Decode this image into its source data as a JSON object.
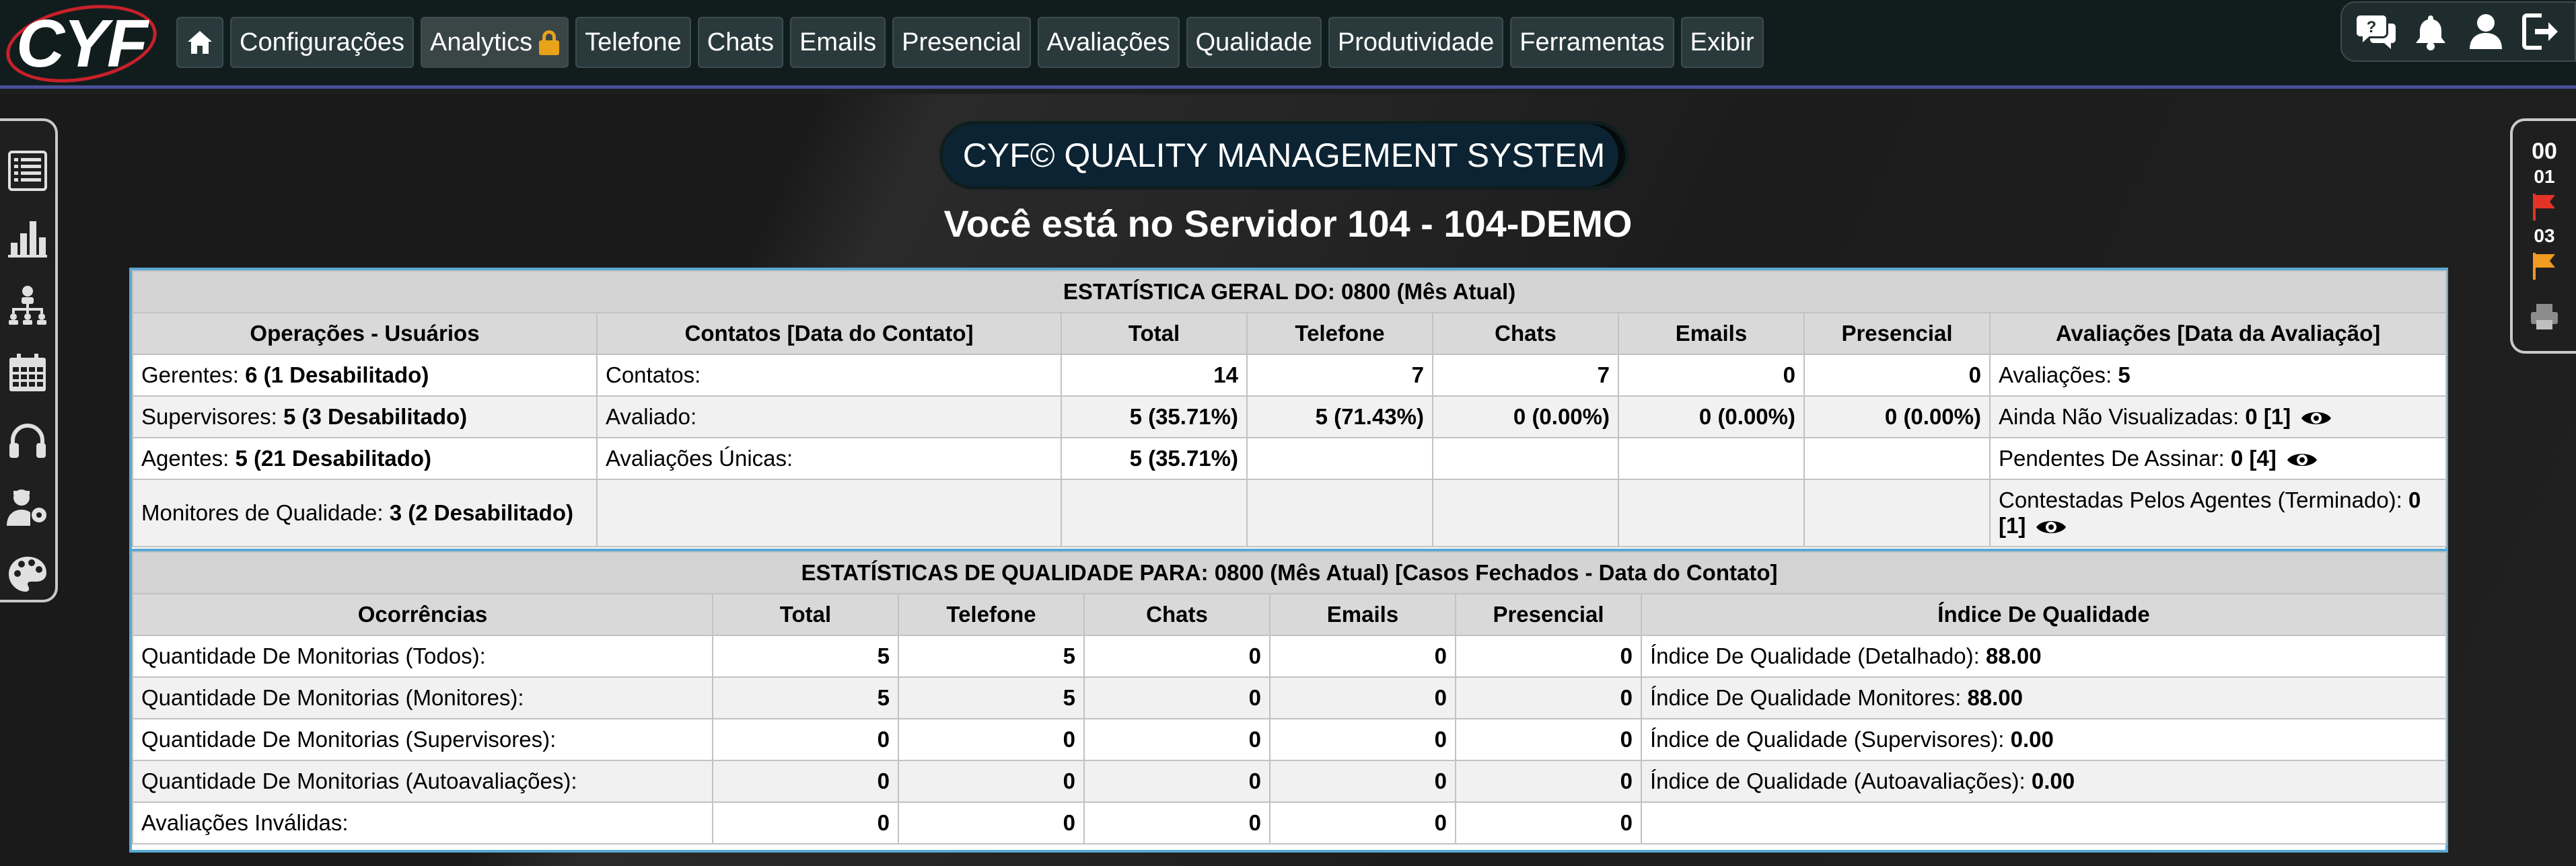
{
  "app": {
    "logo_text": "CYF"
  },
  "nav": {
    "items": [
      "Configurações",
      "Analytics",
      "Telefone",
      "Chats",
      "Emails",
      "Presencial",
      "Avaliações",
      "Qualidade",
      "Produtividade",
      "Ferramentas",
      "Exibir"
    ]
  },
  "right_panel": {
    "top_count": "00",
    "count_1": "01",
    "count_2": "03"
  },
  "header": {
    "system_title": "CYF© QUALITY MANAGEMENT SYSTEM",
    "server_title": "Você está no Servidor 104 - 104-DEMO"
  },
  "colors": {
    "accent_border": "#5aa9d4",
    "nav_bg": "#111d1d",
    "flag_red": "#e53226",
    "flag_orange": "#f29b22",
    "lock": "#e8a319"
  },
  "general": {
    "caption": "ESTATÍSTICA GERAL DO: 0800 (Mês Atual)",
    "headers": [
      "Operações - Usuários",
      "Contatos [Data do Contato]",
      "Total",
      "Telefone",
      "Chats",
      "Emails",
      "Presencial",
      "Avaliações [Data da Avaliação]"
    ],
    "rows": [
      {
        "user_label": "Gerentes: ",
        "user_value": "6 (1 Desabilitado)",
        "contact_label": "Contatos:",
        "total": "14",
        "telefone": "7",
        "chats": "7",
        "emails": "0",
        "presencial": "0",
        "eval_label": "Avaliações: ",
        "eval_value": "5"
      },
      {
        "user_label": "Supervisores: ",
        "user_value": "5 (3 Desabilitado)",
        "contact_label": "Avaliado:",
        "total": "5 (35.71%)",
        "telefone": "5 (71.43%)",
        "chats": "0 (0.00%)",
        "emails": "0 (0.00%)",
        "presencial": "0 (0.00%)",
        "eval_label": "Ainda Não Visualizadas: ",
        "eval_value": "0 [1]"
      },
      {
        "user_label": "Agentes: ",
        "user_value": "5 (21 Desabilitado)",
        "contact_label": "Avaliações Únicas:",
        "total": "5 (35.71%)",
        "telefone": "",
        "chats": "",
        "emails": "",
        "presencial": "",
        "eval_label": "Pendentes De Assinar: ",
        "eval_value": "0 [4]"
      },
      {
        "user_label": "Monitores de Qualidade: ",
        "user_value": "3 (2 Desabilitado)",
        "contact_label": "",
        "total": "",
        "telefone": "",
        "chats": "",
        "emails": "",
        "presencial": "",
        "eval_label": "Contestadas Pelos Agentes (Terminado): ",
        "eval_value": "0 [1]"
      }
    ]
  },
  "quality": {
    "caption": "ESTATÍSTICAS DE QUALIDADE PARA: 0800 (Mês Atual) [Casos Fechados - Data do Contato]",
    "headers": [
      "Ocorrências",
      "Total",
      "Telefone",
      "Chats",
      "Emails",
      "Presencial",
      "Índice De Qualidade"
    ],
    "rows": [
      {
        "label": "Quantidade De Monitorias (Todos):",
        "total": "5",
        "telefone": "5",
        "chats": "0",
        "emails": "0",
        "presencial": "0",
        "idx_label": "Índice De Qualidade (Detalhado): ",
        "idx_value": "88.00"
      },
      {
        "label": "Quantidade De Monitorias (Monitores):",
        "total": "5",
        "telefone": "5",
        "chats": "0",
        "emails": "0",
        "presencial": "0",
        "idx_label": "Índice De Qualidade Monitores: ",
        "idx_value": "88.00"
      },
      {
        "label": "Quantidade De Monitorias (Supervisores):",
        "total": "0",
        "telefone": "0",
        "chats": "0",
        "emails": "0",
        "presencial": "0",
        "idx_label": "Índice de Qualidade (Supervisores): ",
        "idx_value": "0.00"
      },
      {
        "label": "Quantidade De Monitorias (Autoavaliações):",
        "total": "0",
        "telefone": "0",
        "chats": "0",
        "emails": "0",
        "presencial": "0",
        "idx_label": "Índice de Qualidade (Autoavaliações): ",
        "idx_value": "0.00"
      },
      {
        "label": "Avaliações Inválidas:",
        "total": "0",
        "telefone": "0",
        "chats": "0",
        "emails": "0",
        "presencial": "0",
        "idx_label": "",
        "idx_value": ""
      }
    ]
  }
}
